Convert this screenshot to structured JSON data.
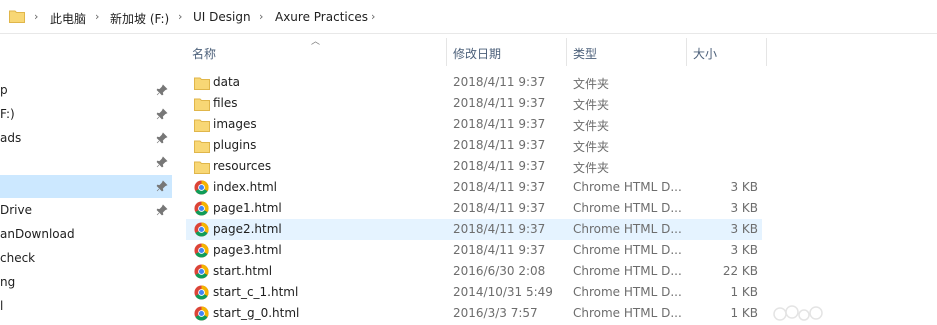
{
  "address": {
    "crumbs": [
      "此电脑",
      "新加坡 (F:)",
      "UI Design",
      "Axure Practices"
    ]
  },
  "nav": {
    "items": [
      {
        "label": "p",
        "pinned": true,
        "selected": false
      },
      {
        "label": "F:)",
        "pinned": true,
        "selected": false
      },
      {
        "label": "ads",
        "pinned": true,
        "selected": false
      },
      {
        "label": "",
        "pinned": true,
        "selected": false
      },
      {
        "label": "",
        "pinned": true,
        "selected": true
      },
      {
        "label": "Drive",
        "pinned": true,
        "selected": false
      },
      {
        "label": "anDownload",
        "pinned": false,
        "selected": false
      },
      {
        "label": "check",
        "pinned": false,
        "selected": false
      },
      {
        "label": "ng",
        "pinned": false,
        "selected": false
      },
      {
        "label": "l",
        "pinned": false,
        "selected": false
      }
    ]
  },
  "columns": {
    "name": "名称",
    "date": "修改日期",
    "type": "类型",
    "size": "大小"
  },
  "files": [
    {
      "name": "data",
      "date": "2018/4/11 9:37",
      "type": "文件夹",
      "size": "",
      "icon": "folder-icon",
      "selected": false
    },
    {
      "name": "files",
      "date": "2018/4/11 9:37",
      "type": "文件夹",
      "size": "",
      "icon": "folder-icon",
      "selected": false
    },
    {
      "name": "images",
      "date": "2018/4/11 9:37",
      "type": "文件夹",
      "size": "",
      "icon": "folder-icon",
      "selected": false
    },
    {
      "name": "plugins",
      "date": "2018/4/11 9:37",
      "type": "文件夹",
      "size": "",
      "icon": "folder-icon",
      "selected": false
    },
    {
      "name": "resources",
      "date": "2018/4/11 9:37",
      "type": "文件夹",
      "size": "",
      "icon": "folder-icon",
      "selected": false
    },
    {
      "name": "index.html",
      "date": "2018/4/11 9:37",
      "type": "Chrome HTML D...",
      "size": "3 KB",
      "icon": "chrome-icon",
      "selected": false
    },
    {
      "name": "page1.html",
      "date": "2018/4/11 9:37",
      "type": "Chrome HTML D...",
      "size": "3 KB",
      "icon": "chrome-icon",
      "selected": false
    },
    {
      "name": "page2.html",
      "date": "2018/4/11 9:37",
      "type": "Chrome HTML D...",
      "size": "3 KB",
      "icon": "chrome-icon",
      "selected": true
    },
    {
      "name": "page3.html",
      "date": "2018/4/11 9:37",
      "type": "Chrome HTML D...",
      "size": "3 KB",
      "icon": "chrome-icon",
      "selected": false
    },
    {
      "name": "start.html",
      "date": "2016/6/30 2:08",
      "type": "Chrome HTML D...",
      "size": "22 KB",
      "icon": "chrome-icon",
      "selected": false
    },
    {
      "name": "start_c_1.html",
      "date": "2014/10/31 5:49",
      "type": "Chrome HTML D...",
      "size": "1 KB",
      "icon": "chrome-icon",
      "selected": false
    },
    {
      "name": "start_g_0.html",
      "date": "2016/3/3 7:57",
      "type": "Chrome HTML D...",
      "size": "1 KB",
      "icon": "chrome-icon",
      "selected": false
    }
  ],
  "colors": {
    "selection": "#cce8ff",
    "row_highlight": "#e5f3ff",
    "folder": "#f8d775",
    "header_text": "#4c607a"
  }
}
